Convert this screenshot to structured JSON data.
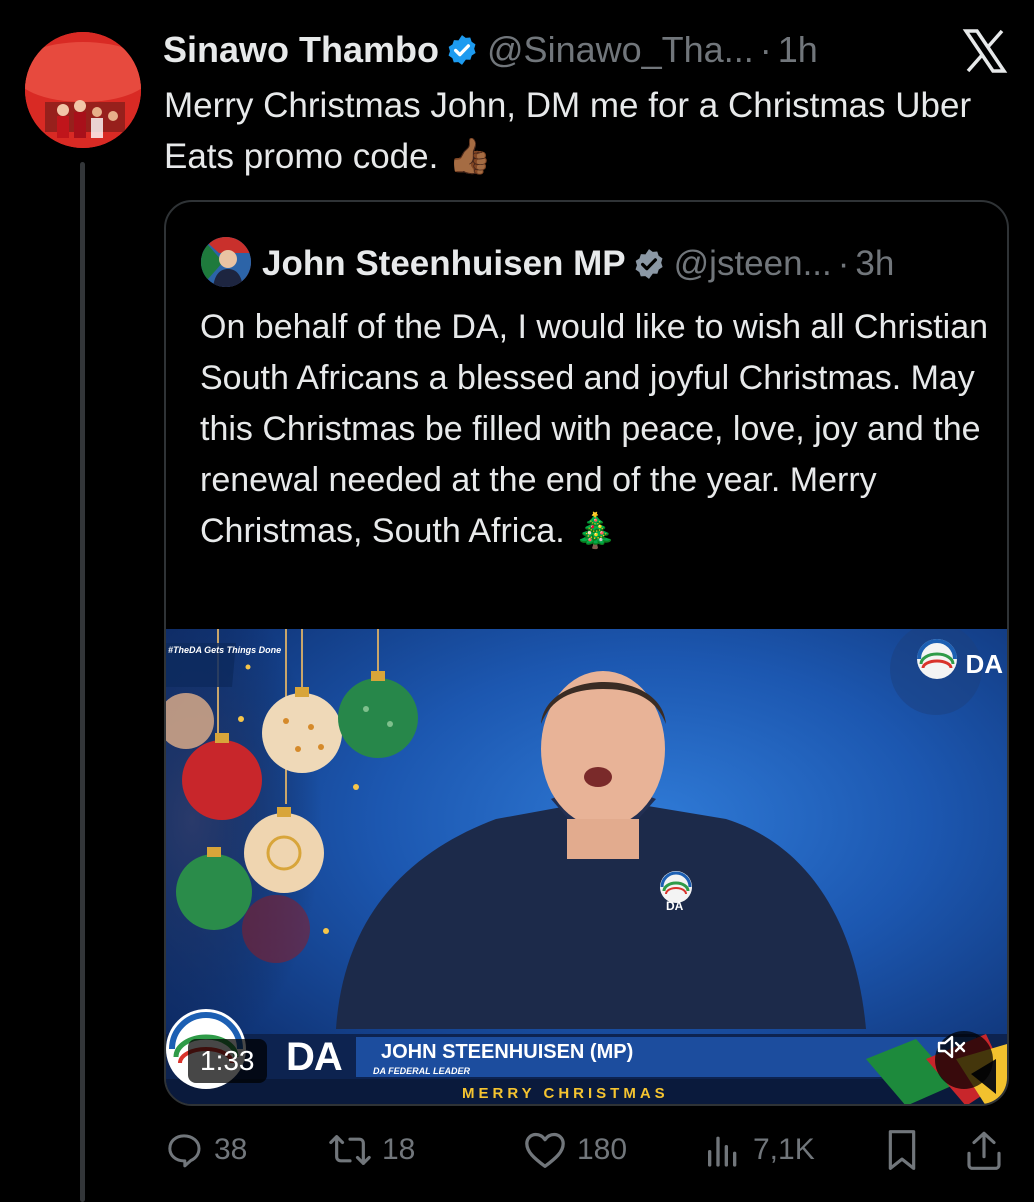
{
  "tweet": {
    "author_name": "Sinawo Thambo",
    "author_handle": "@Sinawo_Tha...",
    "separator": "·",
    "time": "1h",
    "text": "Merry Christmas John, DM me for a Christmas Uber Eats promo code.",
    "text_emoji": "👍🏾"
  },
  "quote": {
    "author_name": "John Steenhuisen MP",
    "author_handle": "@jsteen...",
    "separator": "·",
    "time": "3h",
    "text": "On behalf of the DA, I would like to wish all Christian South Africans a blessed and joyful Christmas. May this Christmas be filled with peace, love, joy and the renewal needed at the end of the year. Merry Christmas, South Africa.",
    "text_emoji": "🎄",
    "video": {
      "duration": "1:33",
      "lower_third_name": "JOHN STEENHUISEN (MP)",
      "lower_third_role": "DA FEDERAL LEADER",
      "banner": "MERRY CHRISTMAS",
      "hashtag": "#TheDA Gets Things Done",
      "logo_text": "DA",
      "shirt_logo_text": "DA",
      "lower_logo_text": "DA"
    }
  },
  "actions": {
    "replies": "38",
    "reposts": "18",
    "likes": "180",
    "views": "7,1K"
  },
  "icons": {
    "platform": "x-logo-icon",
    "verified": "verified-badge-icon",
    "reply": "reply-icon",
    "repost": "repost-icon",
    "like": "heart-icon",
    "views": "views-icon",
    "bookmark": "bookmark-icon",
    "share": "share-icon",
    "mute": "volume-muted-icon"
  },
  "colors": {
    "background": "#000000",
    "text_primary": "#e7e9ea",
    "text_secondary": "#71767b",
    "verified_blue": "#1d9bf0",
    "border": "#2f3336"
  }
}
